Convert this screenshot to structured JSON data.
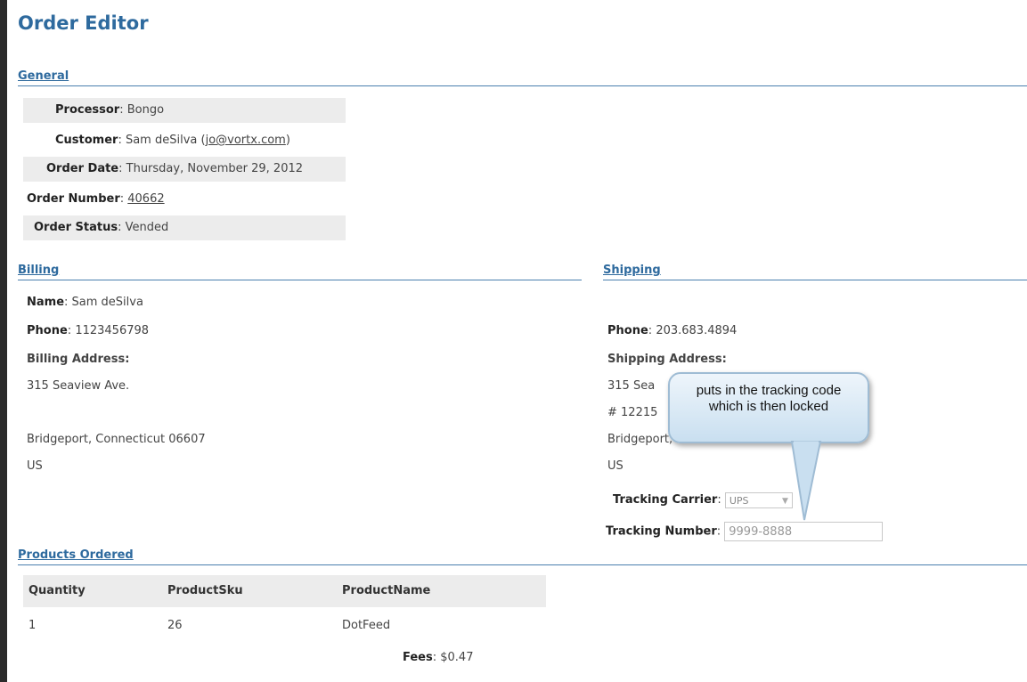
{
  "page": {
    "title": "Order Editor"
  },
  "general": {
    "header": "General",
    "processor": {
      "label": "Processor",
      "value": "Bongo"
    },
    "customer": {
      "label": "Customer",
      "name": "Sam deSilva",
      "email": "jo@vortx.com"
    },
    "order_date": {
      "label": "Order Date",
      "value": "Thursday, November 29, 2012"
    },
    "order_number": {
      "label": "Order Number",
      "value": "40662"
    },
    "order_status": {
      "label": "Order Status",
      "value": "Vended"
    }
  },
  "billing": {
    "header": "Billing",
    "name": {
      "label": "Name",
      "value": "Sam deSilva"
    },
    "phone": {
      "label": "Phone",
      "value": "1123456798"
    },
    "address_label": "Billing Address:",
    "address_line1": "315 Seaview Ave.",
    "city_state_zip": "Bridgeport, Connecticut 06607",
    "country": "US"
  },
  "shipping": {
    "header": "Shipping",
    "phone": {
      "label": "Phone",
      "value": "203.683.4894"
    },
    "address_label": "Shipping Address:",
    "address_line1": "315 Sea",
    "address_line2": "# 12215",
    "city_state_zip": "Bridgeport, CT 06607",
    "country": "US",
    "tracking_carrier": {
      "label": "Tracking Carrier",
      "value": "UPS"
    },
    "tracking_number": {
      "label": "Tracking Number",
      "value": "9999-8888"
    }
  },
  "callout": {
    "text": "puts in the tracking code which is then locked"
  },
  "products": {
    "header": "Products Ordered",
    "columns": [
      "Quantity",
      "ProductSku",
      "ProductName"
    ],
    "rows": [
      {
        "quantity": "1",
        "sku": "26",
        "name": "DotFeed"
      }
    ],
    "fees": {
      "label": "Fees",
      "value": "$0.47"
    }
  }
}
